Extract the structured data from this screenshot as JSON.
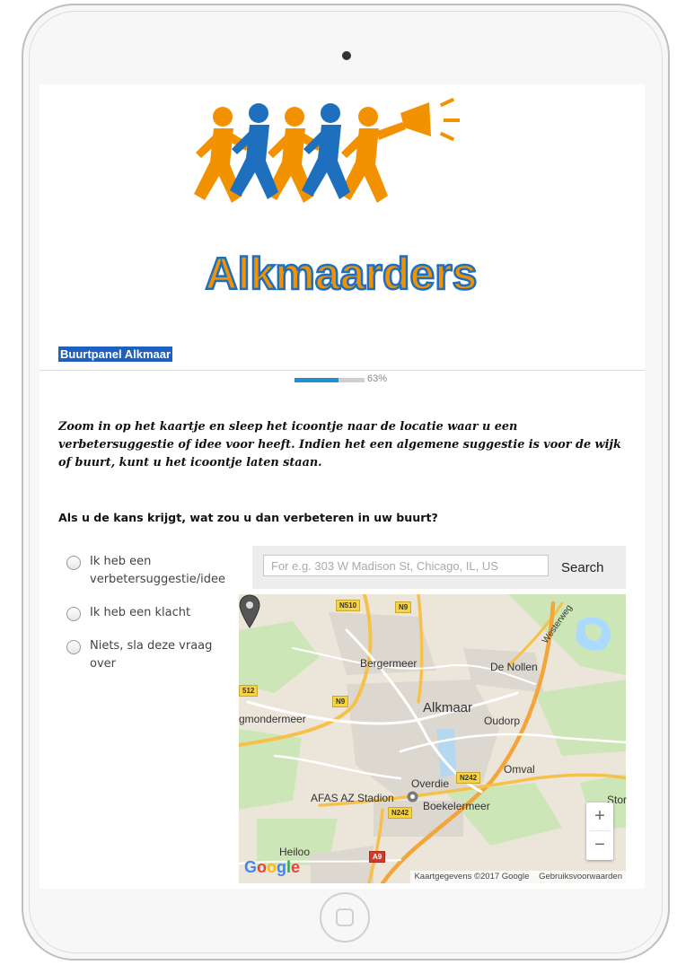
{
  "panel_title": "Buurtpanel Alkmaar",
  "logo_text": "Alkmaarders",
  "progress": {
    "percent": 63,
    "label": "63%"
  },
  "instruction": "Zoom in op het kaartje en sleep het icoontje naar de locatie waar u een verbetersuggestie of idee voor heeft. Indien het een algemene suggestie is voor de wijk of buurt, kunt u het icoontje laten staan.",
  "question": "Als u de kans krijgt, wat zou u dan verbeteren in uw buurt?",
  "options": [
    {
      "label": "Ik heb een verbetersuggestie/idee"
    },
    {
      "label": "Ik heb een klacht"
    },
    {
      "label": "Niets, sla deze vraag over"
    }
  ],
  "map": {
    "search_placeholder": "For e.g. 303 W Madison St, Chicago, IL, US",
    "search_button": "Search",
    "places": {
      "bergermeer": "Bergermeer",
      "de_nollen": "De Nollen",
      "westerweg": "Westerweg",
      "alkmaar": "Alkmaar",
      "oudorp": "Oudorp",
      "egmondermeer": "gmondermeer",
      "omval": "Omval",
      "overdie": "Overdie",
      "afas": "AFAS AZ Stadion",
      "boekelermeer": "Boekelermeer",
      "stompetoren": "Stor",
      "heiloo": "Heiloo"
    },
    "roads": {
      "n510": "N510",
      "n9_top": "N9",
      "n9_mid": "N9",
      "n512": "512",
      "n242_right": "N242",
      "n242_mid": "N242",
      "a9": "A9"
    },
    "zoom_in": "+",
    "zoom_out": "−",
    "google": "Google",
    "attribution_data": "Kaartgegevens ©2017 Google",
    "attribution_terms": "Gebruiksvoorwaarden"
  },
  "colors": {
    "progress_fill": "#1f8fd1",
    "panel_title_bg": "#1f5fbf",
    "logo_orange": "#f39200",
    "logo_blue": "#1f6fbf"
  },
  "icons": {
    "map_pin": "map-pin-icon",
    "stadium": "stadium-icon"
  }
}
